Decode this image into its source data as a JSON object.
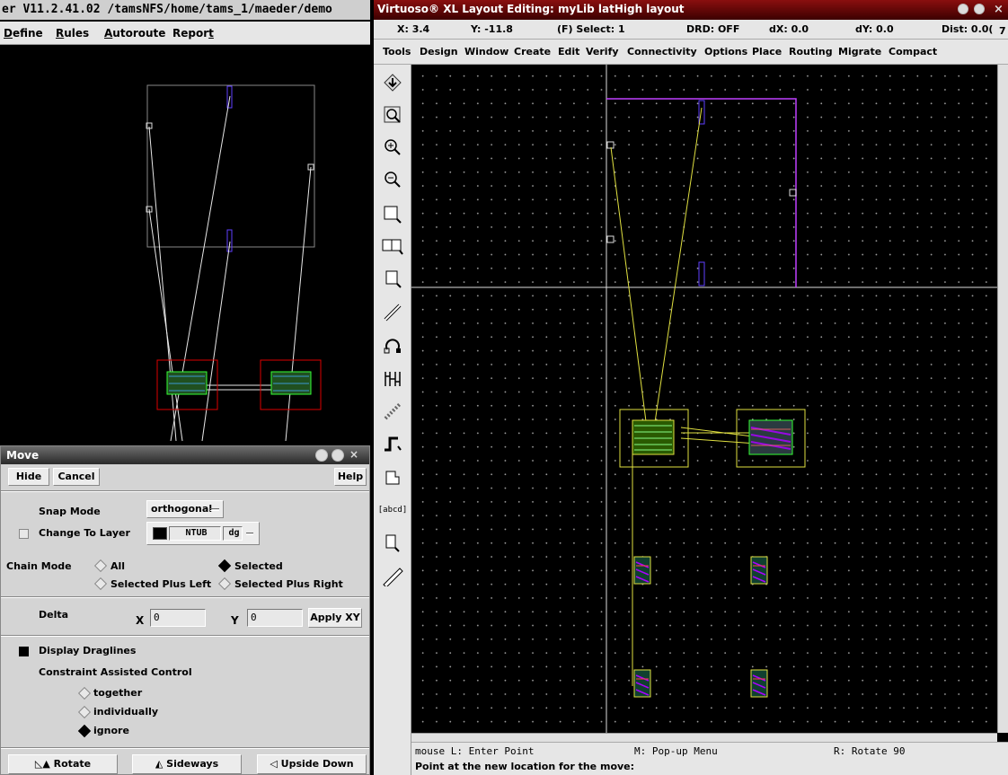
{
  "left_window": {
    "title": "er V11.2.41.02 /tamsNFS/home/tams_1/maeder/demo",
    "menu": [
      {
        "text": "Define",
        "u": "D"
      },
      {
        "text": "Rules",
        "u": "R"
      },
      {
        "text": "Autoroute",
        "u": "A"
      },
      {
        "text": "Report",
        "u": "t"
      }
    ]
  },
  "move_dialog": {
    "title": "Move",
    "hide_label": "Hide",
    "cancel_label": "Cancel",
    "help_label": "Help",
    "snap_mode_label": "Snap Mode",
    "snap_mode_value": "orthogonal",
    "change_to_layer_label": "Change To Layer",
    "layer_name": "NTUB",
    "layer_purpose": "dg",
    "chain_mode_label": "Chain Mode",
    "chain_all": "All",
    "chain_selected": "Selected",
    "chain_selected_plus_left": "Selected Plus Left",
    "chain_selected_plus_right": "Selected Plus Right",
    "delta_label": "Delta",
    "x_label": "X",
    "y_label": "Y",
    "delta_x": "0",
    "delta_y": "0",
    "apply_xy_label": "Apply XY",
    "display_draglines_label": "Display Draglines",
    "constraint_label": "Constraint Assisted Control",
    "opt_together": "together",
    "opt_individually": "individually",
    "opt_ignore": "ignore",
    "rotate_label": "Rotate",
    "sideways_label": "Sideways",
    "upside_down_label": "Upside Down"
  },
  "right_window": {
    "title": "Virtuoso® XL Layout Editing: myLib latHigh layout",
    "coords": {
      "x": "X:  3.4",
      "y": "Y: -11.8",
      "select": "(F) Select: 1",
      "drd": "DRD: OFF",
      "dx": "dX:  0.0",
      "dy": "dY:  0.0",
      "dist": "Dist: 0.0(",
      "extra": "7"
    },
    "menu": [
      "Tools",
      "Design",
      "Window",
      "Create",
      "Edit",
      "Verify",
      "Connectivity",
      "Options",
      "Place",
      "Routing",
      "Migrate",
      "Compact"
    ],
    "tool_icons": [
      "save-icon",
      "zoom-fit-icon",
      "zoom-in-icon",
      "zoom-out-icon",
      "stretch-icon",
      "copy-icon",
      "move-icon",
      "path-icon",
      "undo-icon",
      "array-icon",
      "wire-icon",
      "step-icon",
      "polygon-icon",
      "label-icon",
      "select-icon",
      "ruler-icon"
    ],
    "label_icon_text": "[abcd]",
    "status_mouse_l": "mouse L: Enter Point",
    "status_mouse_m": "M: Pop-up Menu",
    "status_mouse_r": "R: Rotate 90",
    "prompt": "Point at the new location for the move:"
  },
  "colors": {
    "title_red": "#6b0000",
    "panel_gray": "#d4d4d4",
    "boundary_purple": "#c040ff",
    "flight_yellow": "#e0e040"
  }
}
